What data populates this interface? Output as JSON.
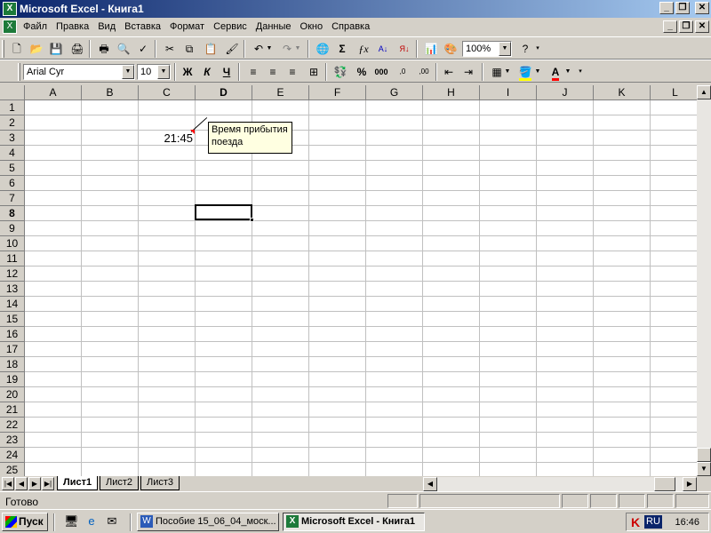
{
  "window": {
    "title": "Microsoft Excel - Книга1"
  },
  "menu": [
    "Файл",
    "Правка",
    "Вид",
    "Вставка",
    "Формат",
    "Сервис",
    "Данные",
    "Окно",
    "Справка"
  ],
  "toolbar": {
    "zoom": "100%",
    "font": "Arial Cyr",
    "font_size": "10",
    "bold": "Ж",
    "italic": "К",
    "underline": "Ч",
    "currency": "%",
    "thousands": "000",
    "inc_dec": ",0",
    "dec_dec": ",00"
  },
  "columns": [
    "A",
    "B",
    "C",
    "D",
    "E",
    "F",
    "G",
    "H",
    "I",
    "J",
    "K",
    "L"
  ],
  "rows": [
    "1",
    "2",
    "3",
    "4",
    "5",
    "6",
    "7",
    "8",
    "9",
    "10",
    "11",
    "12",
    "13",
    "14",
    "15",
    "16",
    "17",
    "18",
    "19",
    "20",
    "21",
    "22",
    "23",
    "24",
    "25"
  ],
  "cells": {
    "C3": "21:45"
  },
  "comment": {
    "line1": "Время прибытия",
    "line2": "поезда"
  },
  "sheets": [
    "Лист1",
    "Лист2",
    "Лист3"
  ],
  "status": {
    "text": "Готово"
  },
  "taskbar": {
    "start": "Пуск",
    "task1": "Пособие 15_06_04_моск...",
    "task2": "Microsoft Excel - Книга1",
    "lang": "RU",
    "clock": "16:46"
  }
}
